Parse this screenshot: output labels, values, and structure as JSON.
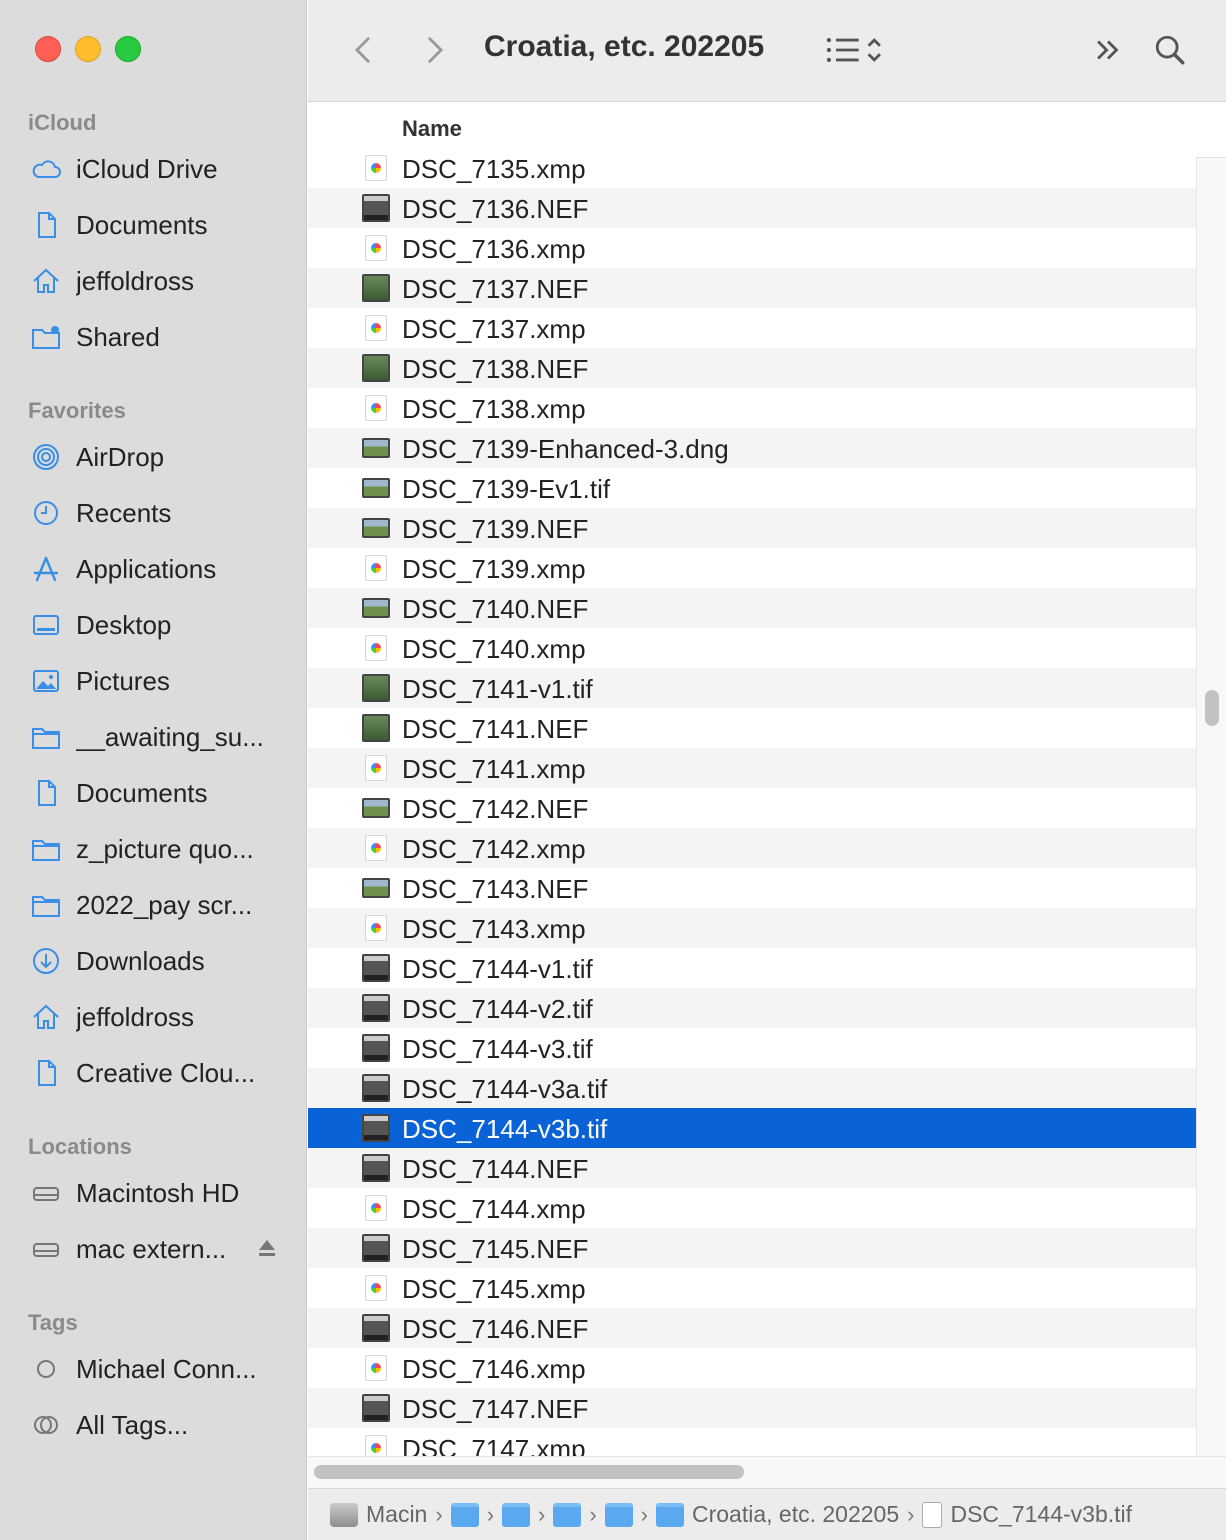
{
  "window": {
    "title": "Croatia, etc. 202205"
  },
  "sidebar": {
    "sections": [
      {
        "title": "iCloud"
      },
      {
        "title": "Favorites"
      },
      {
        "title": "Locations"
      },
      {
        "title": "Tags"
      }
    ],
    "icloud": [
      {
        "label": "iCloud Drive",
        "icon": "cloud-icon"
      },
      {
        "label": "Documents",
        "icon": "document-icon"
      },
      {
        "label": "jeffoldross",
        "icon": "home-icon"
      },
      {
        "label": "Shared",
        "icon": "shared-folder-icon"
      }
    ],
    "favorites": [
      {
        "label": "AirDrop",
        "icon": "airdrop-icon"
      },
      {
        "label": "Recents",
        "icon": "clock-icon"
      },
      {
        "label": "Applications",
        "icon": "applications-icon"
      },
      {
        "label": "Desktop",
        "icon": "desktop-icon"
      },
      {
        "label": "Pictures",
        "icon": "pictures-icon"
      },
      {
        "label": "__awaiting_su...",
        "icon": "folder-icon"
      },
      {
        "label": "Documents",
        "icon": "document-icon"
      },
      {
        "label": "z_picture quo...",
        "icon": "folder-icon"
      },
      {
        "label": "2022_pay scr...",
        "icon": "folder-icon"
      },
      {
        "label": "Downloads",
        "icon": "download-icon"
      },
      {
        "label": "jeffoldross",
        "icon": "home-icon"
      },
      {
        "label": "Creative Clou...",
        "icon": "document-icon"
      }
    ],
    "locations": [
      {
        "label": "Macintosh HD",
        "icon": "drive-icon"
      },
      {
        "label": "mac extern...",
        "icon": "drive-icon"
      }
    ],
    "tags": [
      {
        "label": "Michael Conn...",
        "icon": "tag-circle-icon"
      },
      {
        "label": "All Tags...",
        "icon": "all-tags-icon"
      }
    ]
  },
  "columns": {
    "name": "Name"
  },
  "files": [
    {
      "name": "DSC_7135.xmp",
      "type": "xmp"
    },
    {
      "name": "DSC_7136.NEF",
      "type": "dark"
    },
    {
      "name": "DSC_7136.xmp",
      "type": "xmp"
    },
    {
      "name": "DSC_7137.NEF",
      "type": "img"
    },
    {
      "name": "DSC_7137.xmp",
      "type": "xmp"
    },
    {
      "name": "DSC_7138.NEF",
      "type": "img"
    },
    {
      "name": "DSC_7138.xmp",
      "type": "xmp"
    },
    {
      "name": "DSC_7139-Enhanced-3.dng",
      "type": "land"
    },
    {
      "name": "DSC_7139-Ev1.tif",
      "type": "land"
    },
    {
      "name": "DSC_7139.NEF",
      "type": "land"
    },
    {
      "name": "DSC_7139.xmp",
      "type": "xmp"
    },
    {
      "name": "DSC_7140.NEF",
      "type": "land"
    },
    {
      "name": "DSC_7140.xmp",
      "type": "xmp"
    },
    {
      "name": "DSC_7141-v1.tif",
      "type": "img"
    },
    {
      "name": "DSC_7141.NEF",
      "type": "img"
    },
    {
      "name": "DSC_7141.xmp",
      "type": "xmp"
    },
    {
      "name": "DSC_7142.NEF",
      "type": "land"
    },
    {
      "name": "DSC_7142.xmp",
      "type": "xmp"
    },
    {
      "name": "DSC_7143.NEF",
      "type": "land"
    },
    {
      "name": "DSC_7143.xmp",
      "type": "xmp"
    },
    {
      "name": "DSC_7144-v1.tif",
      "type": "dark"
    },
    {
      "name": "DSC_7144-v2.tif",
      "type": "dark"
    },
    {
      "name": "DSC_7144-v3.tif",
      "type": "dark"
    },
    {
      "name": "DSC_7144-v3a.tif",
      "type": "dark"
    },
    {
      "name": "DSC_7144-v3b.tif",
      "type": "dark",
      "selected": true
    },
    {
      "name": "DSC_7144.NEF",
      "type": "dark"
    },
    {
      "name": "DSC_7144.xmp",
      "type": "xmp"
    },
    {
      "name": "DSC_7145.NEF",
      "type": "dark"
    },
    {
      "name": "DSC_7145.xmp",
      "type": "xmp"
    },
    {
      "name": "DSC_7146.NEF",
      "type": "dark"
    },
    {
      "name": "DSC_7146.xmp",
      "type": "xmp"
    },
    {
      "name": "DSC_7147.NEF",
      "type": "dark"
    },
    {
      "name": "DSC_7147.xmp",
      "type": "xmp"
    }
  ],
  "pathbar": {
    "disk": "Macin",
    "folder": "Croatia, etc. 202205",
    "file": "DSC_7144-v3b.tif"
  },
  "colors": {
    "selection": "#0a63d6",
    "sidebar_icon": "#3a8ee6"
  }
}
